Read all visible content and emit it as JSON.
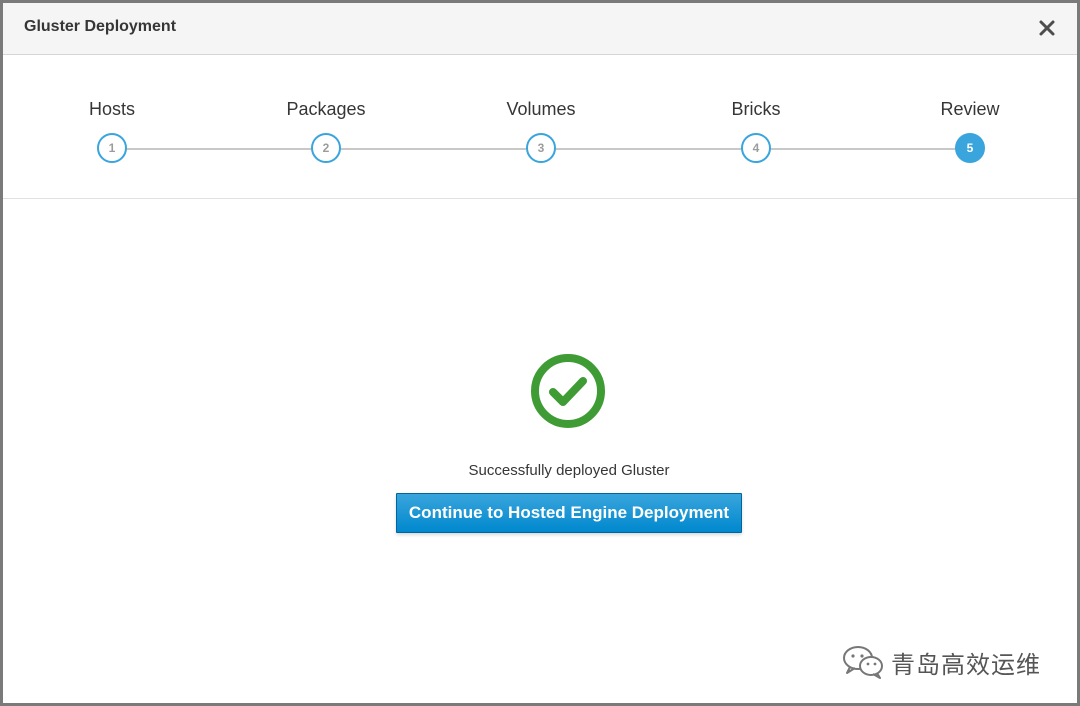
{
  "dialog": {
    "title": "Gluster Deployment",
    "close_icon": "close-icon"
  },
  "wizard": {
    "accent_color": "#39a5dc",
    "active_step": 5,
    "steps": [
      {
        "label": "Hosts",
        "number": "1"
      },
      {
        "label": "Packages",
        "number": "2"
      },
      {
        "label": "Volumes",
        "number": "3"
      },
      {
        "label": "Bricks",
        "number": "4"
      },
      {
        "label": "Review",
        "number": "5"
      }
    ]
  },
  "result": {
    "icon": "check-circle-icon",
    "icon_color": "#3f9c35",
    "message": "Successfully deployed Gluster",
    "continue_label": "Continue to Hosted Engine Deployment"
  },
  "watermark": {
    "icon": "wechat-icon",
    "text": "青岛高效运维"
  }
}
